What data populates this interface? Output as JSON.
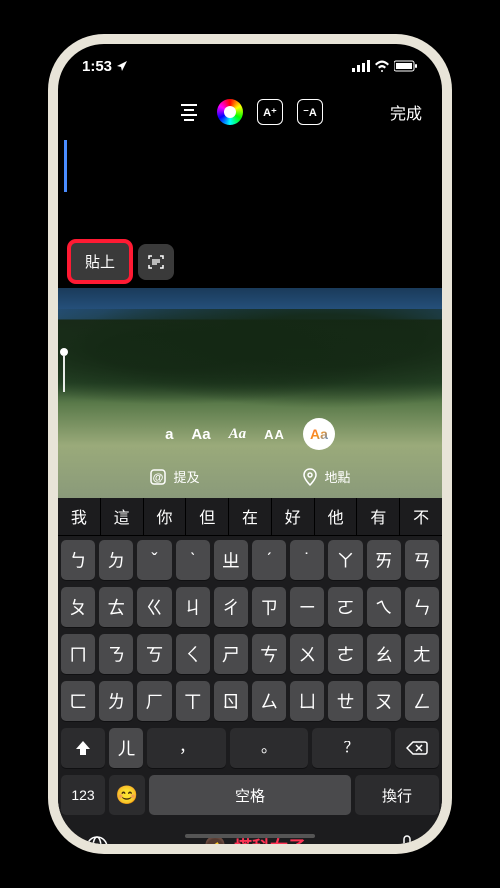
{
  "status": {
    "time": "1:53",
    "location_arrow": "➤"
  },
  "toolbar": {
    "done": "完成",
    "effect1": "A⁺",
    "effect2": "⁻A"
  },
  "paste_menu": {
    "paste": "貼上"
  },
  "fonts": {
    "a": "a",
    "aa1": "Aa",
    "aa_italic": "Aa",
    "aa_caps": "AA",
    "aa_active": "Aa"
  },
  "tags": {
    "mention": "提及",
    "location": "地點"
  },
  "suggest": [
    "我",
    "這",
    "你",
    "但",
    "在",
    "好",
    "他",
    "有",
    "不"
  ],
  "keys": {
    "r1": [
      "ㄅ",
      "ㄉ",
      "ˇ",
      "ˋ",
      "ㄓ",
      "ˊ",
      "˙",
      "ㄚ",
      "ㄞ",
      "ㄢ"
    ],
    "r2": [
      "ㄆ",
      "ㄊ",
      "ㄍ",
      "ㄐ",
      "ㄔ",
      "ㄗ",
      "ㄧ",
      "ㄛ",
      "ㄟ",
      "ㄣ"
    ],
    "r3": [
      "ㄇ",
      "ㄋ",
      "ㄎ",
      "ㄑ",
      "ㄕ",
      "ㄘ",
      "ㄨ",
      "ㄜ",
      "ㄠ",
      "ㄤ"
    ],
    "r4": [
      "ㄈ",
      "ㄌ",
      "ㄏ",
      "ㄒ",
      "ㄖ",
      "ㄙ",
      "ㄩ",
      "ㄝ",
      "ㄡ",
      "ㄥ"
    ],
    "r5_mid": [
      "ㄦ"
    ],
    "num": "123",
    "space": "空格",
    "return": "換行"
  },
  "watermark": "塔科女子"
}
